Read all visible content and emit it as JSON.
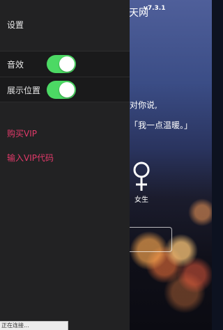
{
  "background": {
    "app_title": "天网",
    "version": "v7.3.1",
    "line1": "对你说,",
    "line2": "「我一点温暖。」",
    "gender_option": "女生",
    "icon": "female-symbol-icon"
  },
  "drawer": {
    "title": "设置",
    "toggles": [
      {
        "label": "音效",
        "on": true
      },
      {
        "label": "展示位置",
        "on": true
      }
    ],
    "buy_vip": "购买VIP",
    "enter_vip_code": "输入VIP代码",
    "accent_color": "#e23a6a",
    "switch_color": "#4cd964"
  },
  "status": {
    "text": "正在连接..."
  }
}
